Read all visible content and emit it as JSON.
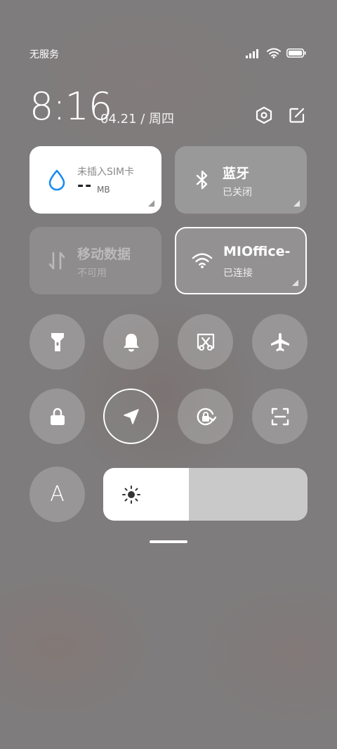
{
  "status_bar": {
    "carrier": "无服务"
  },
  "header": {
    "time": "8:16",
    "date": "04.21 / 周四"
  },
  "tiles": {
    "data_usage": {
      "title": "未插入SIM卡",
      "value": "--",
      "unit": "MB"
    },
    "bluetooth": {
      "title": "蓝牙",
      "status": "已关闭"
    },
    "mobile_data": {
      "title": "移动数据",
      "status": "不可用"
    },
    "wifi": {
      "title": "MIOffice-",
      "status": "已连接"
    }
  },
  "font_button": {
    "label": "A"
  },
  "brightness": {
    "level_fraction": 0.42
  },
  "colors": {
    "accent_blue": "#1a8cf0",
    "tile_white": "#ffffff"
  }
}
